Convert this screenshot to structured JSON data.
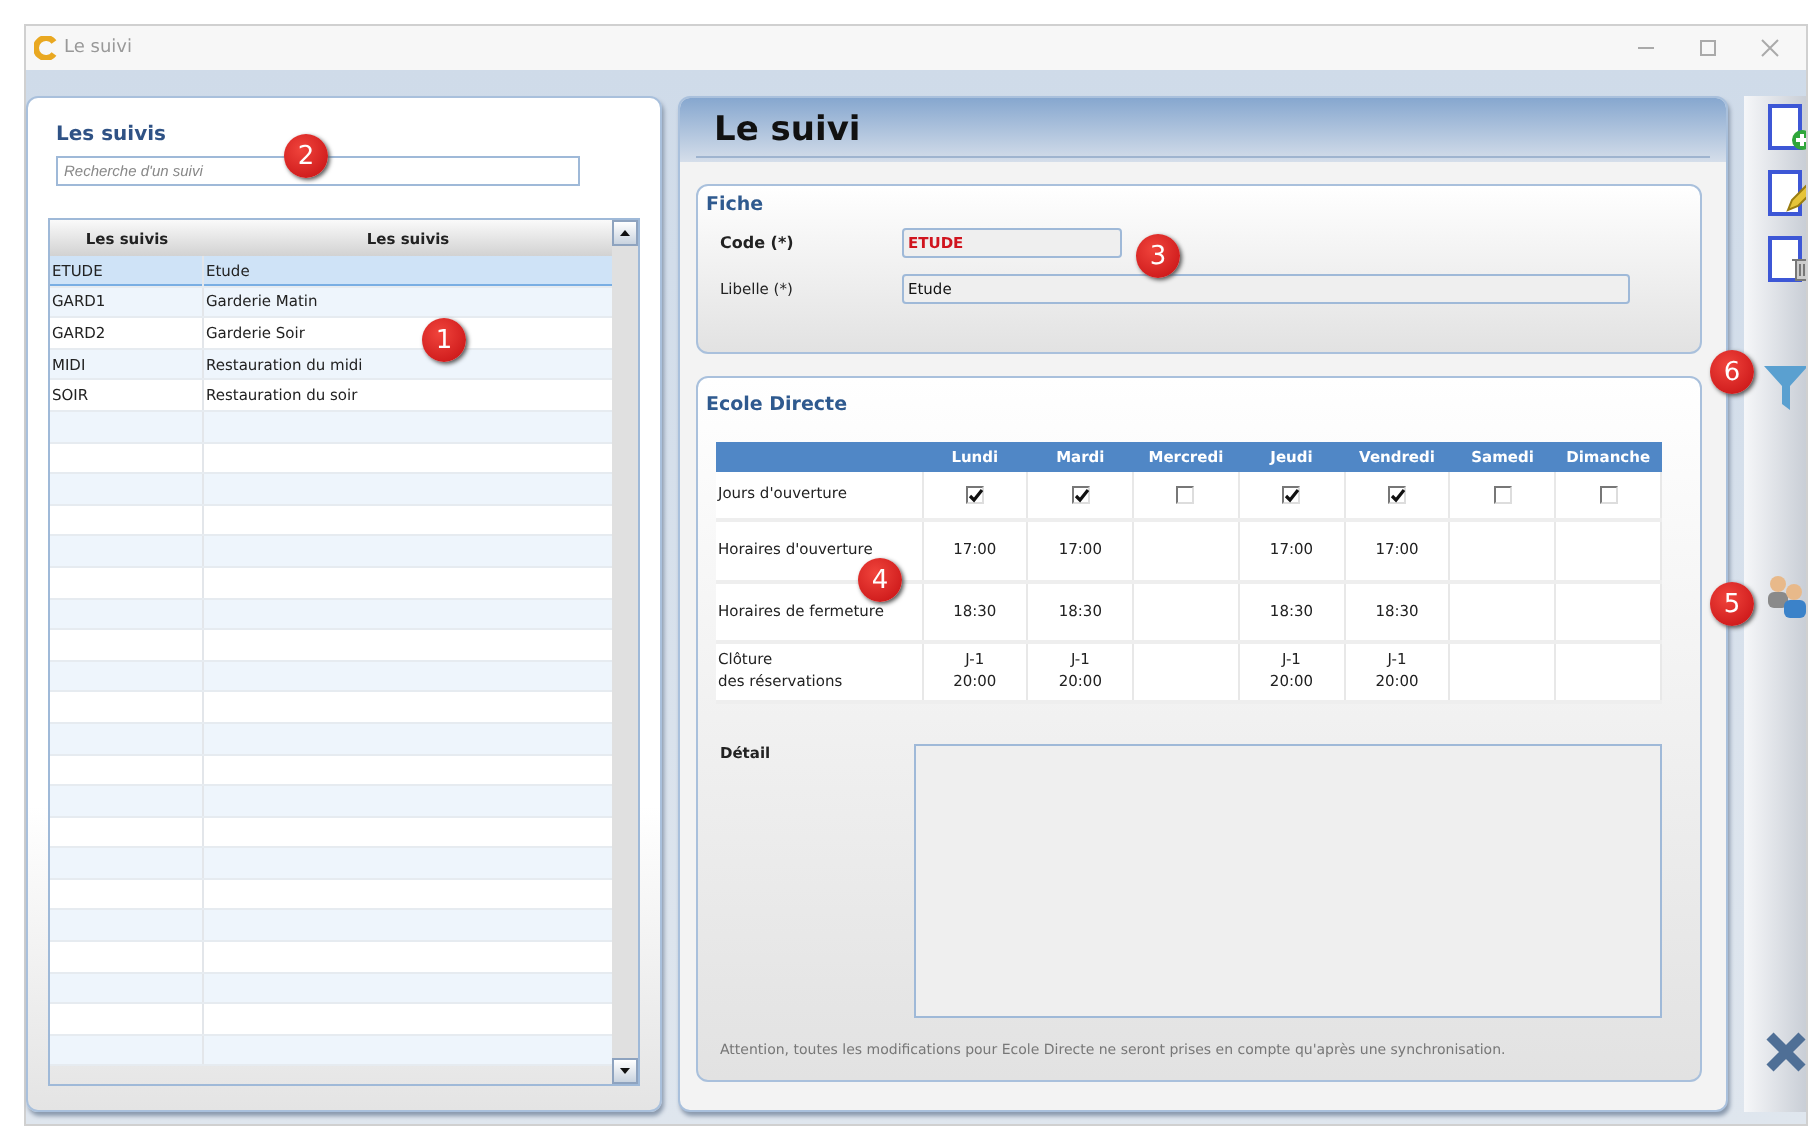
{
  "window": {
    "title": "Le suivi"
  },
  "list_panel": {
    "title": "Les suivis",
    "search": {
      "placeholder": "Recherche d'un suivi"
    },
    "columns": [
      "Les suivis",
      "Les suivis"
    ],
    "rows": [
      {
        "code": "ETUDE",
        "label": "Etude",
        "selected": true
      },
      {
        "code": "GARD1",
        "label": "Garderie Matin",
        "selected": false
      },
      {
        "code": "GARD2",
        "label": "Garderie Soir",
        "selected": false
      },
      {
        "code": "MIDI",
        "label": "Restauration du midi",
        "selected": false
      },
      {
        "code": "SOIR",
        "label": "Restauration du soir",
        "selected": false
      }
    ]
  },
  "detail_panel": {
    "title": "Le suivi",
    "fiche": {
      "title": "Fiche",
      "fields": [
        {
          "label": "Code (*)",
          "value": "ETUDE",
          "kind": "code"
        },
        {
          "label": "Libelle (*)",
          "value": "Etude",
          "kind": "text"
        }
      ]
    },
    "ecole_directe": {
      "title": "Ecole Directe",
      "days": [
        "Lundi",
        "Mardi",
        "Mercredi",
        "Jeudi",
        "Vendredi",
        "Samedi",
        "Dimanche"
      ],
      "rows": [
        {
          "label": "Jours d'ouverture",
          "kind": "checkbox",
          "cells": [
            {
              "checked": true
            },
            {
              "checked": true
            },
            {
              "checked": false
            },
            {
              "checked": true
            },
            {
              "checked": true
            },
            {
              "checked": false
            },
            {
              "checked": false
            }
          ]
        },
        {
          "label": "Horaires d'ouverture",
          "kind": "text",
          "cells": [
            "17:00",
            "17:00",
            "",
            "17:00",
            "17:00",
            "",
            ""
          ]
        },
        {
          "label": "Horaires de fermeture",
          "kind": "text",
          "cells": [
            "18:30",
            "18:30",
            "",
            "18:30",
            "18:30",
            "",
            ""
          ]
        },
        {
          "label": "Clôture\ndes réservations",
          "kind": "text",
          "cells": [
            "J-1\n20:00",
            "J-1\n20:00",
            "",
            "J-1\n20:00",
            "J-1\n20:00",
            "",
            ""
          ]
        }
      ],
      "detail_label": "Détail",
      "note": "Attention, toutes les modifications pour Ecole Directe ne seront prises en compte qu'après une synchronisation."
    }
  },
  "callouts": [
    "2",
    "1",
    "3",
    "6",
    "4",
    "5"
  ]
}
